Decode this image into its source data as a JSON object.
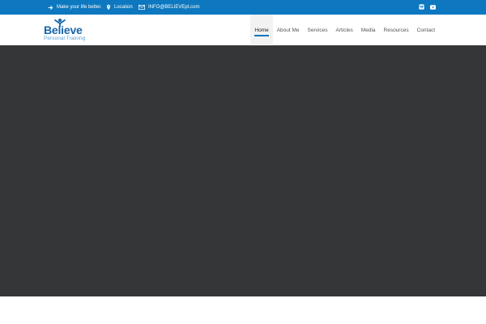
{
  "topbar": {
    "tagline": "Make your life better.",
    "location": "Location",
    "email": "INFO@BELIEVEpt.com",
    "icons": {
      "tagline": "arrow-right-icon",
      "location": "map-pin-icon",
      "email": "envelope-icon",
      "instagram": "instagram-icon",
      "youtube": "youtube-icon"
    }
  },
  "logo": {
    "word": "Believe",
    "sub": "Personal Training"
  },
  "nav": {
    "items": [
      {
        "label": "Home",
        "active": true
      },
      {
        "label": "About Me",
        "active": false
      },
      {
        "label": "Services",
        "active": false
      },
      {
        "label": "Articles",
        "active": false
      },
      {
        "label": "Media",
        "active": false
      },
      {
        "label": "Resources",
        "active": false
      },
      {
        "label": "Contact",
        "active": false
      }
    ]
  },
  "colors": {
    "brand_blue": "#0d78bf",
    "logo_blue": "#1565a8",
    "hero_dark": "#353637"
  }
}
